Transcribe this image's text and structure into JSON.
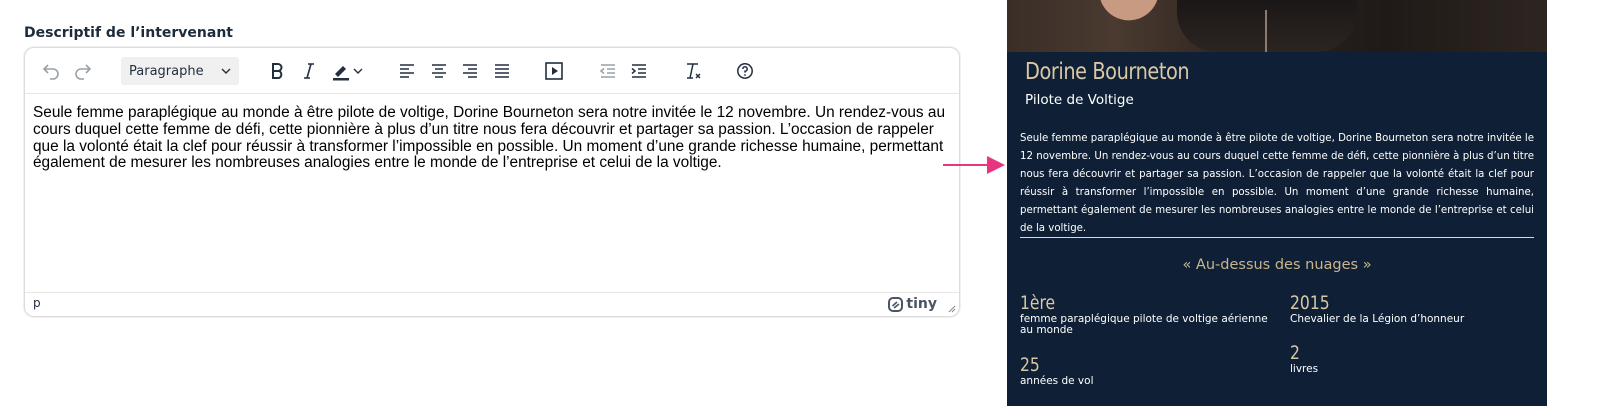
{
  "form": {
    "field_label": "Descriptif de l’intervenant"
  },
  "editor": {
    "toolbar": {
      "format_select": "Paragraphe",
      "icons": [
        "undo-icon",
        "redo-icon",
        "bold-icon",
        "italic-icon",
        "highlight-color-icon",
        "align-left-icon",
        "align-center-icon",
        "align-right-icon",
        "justify-icon",
        "media-icon",
        "outdent-icon",
        "indent-icon",
        "remove-format-icon",
        "help-icon"
      ]
    },
    "content": "Seule femme paraplégique au monde à être pilote de voltige, Dorine Bourneton sera notre invitée le 12 novembre. Un rendez-vous au cours duquel cette femme de défi, cette pionnière à plus d’un titre nous fera découvrir et partager sa passion. L’occasion de rappeler que la volonté était la clef pour réussir à transformer l’impossible en possible. Un moment d’une grande richesse humaine, permettant également de mesurer les nombreuses analogies entre le monde de l’entreprise et celui de la voltige.",
    "status_path": "p",
    "brand": "tiny"
  },
  "preview": {
    "name": "Dorine Bourneton",
    "role": "Pilote de Voltige",
    "description": "Seule femme paraplégique au monde à être pilote de voltige, Dorine Bourneton sera notre invitée le 12 novembre. Un rendez-vous au cours duquel cette femme de défi, cette pionnière à plus d’un titre nous fera découvrir et partager sa passion. L’occasion de rappeler que la volonté était la clef pour réussir à transformer l’impossible en possible. Un moment d’une grande richesse humaine, permettant également de mesurer les nombreuses analogies entre le monde de l’entreprise et celui de la voltige.",
    "quote": "« Au-dessus des nuages »",
    "stats": [
      {
        "num": "1ère",
        "label": "femme paraplégique pilote de voltige aérienne au monde"
      },
      {
        "num": "2015",
        "label": "Chevalier de la Légion d’honneur"
      },
      {
        "num": "25",
        "label": "années de vol"
      },
      {
        "num": "2",
        "label": "livres"
      }
    ]
  },
  "colors": {
    "panel_bg": "#0f2036",
    "accent_gold": "#d9c8a5",
    "arrow": "#e8357f"
  }
}
